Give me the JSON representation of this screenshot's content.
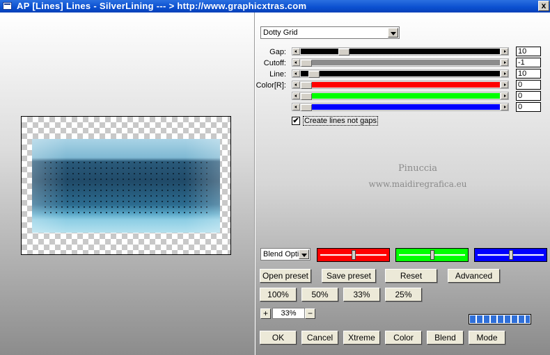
{
  "window": {
    "title": "AP [Lines]  Lines - SilverLining    --- > http://www.graphicxtras.com",
    "close_label": "x"
  },
  "effect": {
    "selected": "Dotty Grid"
  },
  "params": [
    {
      "label": "Gap:",
      "value": "10",
      "fill": "#000000",
      "position": 0.2
    },
    {
      "label": "Cutoff:",
      "value": "-1",
      "fill": "#8c8c8c",
      "position": 0.0
    },
    {
      "label": "Line:",
      "value": "10",
      "fill": "#000000",
      "position": 0.04
    },
    {
      "label": "Color[R]:",
      "value": "0",
      "fill": "#ff0000",
      "position": 0.0
    },
    {
      "label": "",
      "value": "0",
      "fill": "#00ff00",
      "position": 0.0
    },
    {
      "label": "",
      "value": "0",
      "fill": "#0000ff",
      "position": 0.0
    }
  ],
  "create_lines": {
    "label": "Create lines not gaps",
    "checked": true,
    "mark": "✔"
  },
  "watermark": {
    "line1": "Pinuccia",
    "line2": "www.maidiregrafica.eu"
  },
  "blend_options": {
    "selected": "Blend Opti"
  },
  "color_swatches": [
    {
      "color": "#ff0000",
      "level": 0.5
    },
    {
      "color": "#00ff00",
      "level": 0.5
    },
    {
      "color": "#0000ff",
      "level": 0.5
    }
  ],
  "preset_buttons": {
    "open": "Open preset",
    "save": "Save preset",
    "reset": "Reset",
    "advanced": "Advanced"
  },
  "zoom_buttons": [
    "100%",
    "50%",
    "33%",
    "25%"
  ],
  "zoom": {
    "plus": "+",
    "value": "33%",
    "minus": "−"
  },
  "progress": {
    "value": 1.0
  },
  "bottom_buttons": {
    "ok": "OK",
    "cancel": "Cancel",
    "xtreme": "Xtreme",
    "color": "Color",
    "blend": "Blend",
    "mode": "Mode"
  }
}
